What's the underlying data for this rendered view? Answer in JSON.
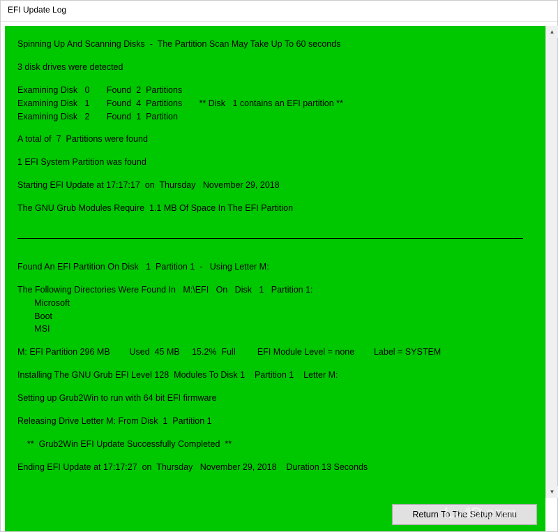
{
  "window": {
    "title": "EFI Update Log"
  },
  "log": {
    "lines": [
      "Spinning Up And Scanning Disks  -  The Partition Scan May Take Up To 60 seconds",
      "",
      "3 disk drives were detected",
      "",
      "Examining Disk   0       Found  2  Partitions",
      "Examining Disk   1       Found  4  Partitions       ** Disk   1 contains an EFI partition **",
      "Examining Disk   2       Found  1  Partition",
      "",
      "A total of  7  Partitions were found",
      "",
      "1 EFI System Partition was found",
      "",
      "Starting EFI Update at 17:17:17  on  Thursday   November 29, 2018",
      "",
      "The GNU Grub Modules Require  1.1 MB Of Space In The EFI Partition",
      "",
      "---HR---",
      "",
      "Found An EFI Partition On Disk   1  Partition 1  -   Using Letter M:",
      "",
      "The Following Directories Were Found In   M:\\EFI   On   Disk   1   Partition 1:",
      "       Microsoft",
      "       Boot",
      "       MSI",
      "",
      "M: EFI Partition 296 MB        Used  45 MB     15.2%  Full         EFI Module Level = none        Label = SYSTEM",
      "",
      "Installing The GNU Grub EFI Level 128  Modules To Disk 1    Partition 1    Letter M:",
      "",
      "Setting up Grub2Win to run with 64 bit EFI firmware",
      "",
      "Releasing Drive Letter M: From Disk  1  Partition 1",
      "",
      "    **  Grub2Win EFI Update Successfully Completed  **",
      "",
      "Ending EFI Update at 17:17:27  on  Thursday   November 29, 2018    Duration 13 Seconds"
    ]
  },
  "buttons": {
    "return": "Return To The Setup Menu"
  },
  "watermark": {
    "text_left": "L",
    "text_right": "4D.com"
  }
}
